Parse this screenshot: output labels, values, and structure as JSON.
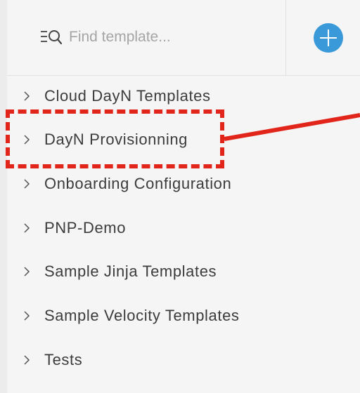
{
  "search": {
    "placeholder": "Find template..."
  },
  "toolbar": {
    "add_icon": "plus-icon",
    "accent_color": "#3a9ad9"
  },
  "tree": {
    "items": [
      {
        "label": "Cloud DayN Templates"
      },
      {
        "label": "DayN Provisionning"
      },
      {
        "label": "Onboarding Configuration"
      },
      {
        "label": "PNP-Demo"
      },
      {
        "label": "Sample Jinja Templates"
      },
      {
        "label": "Sample Velocity Templates"
      },
      {
        "label": "Tests"
      }
    ]
  },
  "annotation": {
    "color": "#e1251b",
    "highlighted_item": "DayN Provisionning"
  }
}
